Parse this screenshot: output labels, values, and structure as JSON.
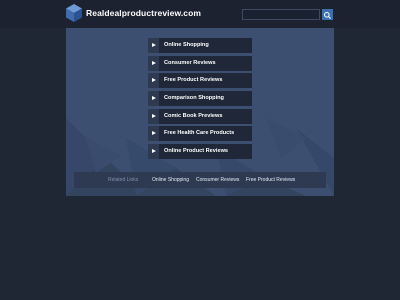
{
  "header": {
    "site_title": "Realdealproductreview.com",
    "search_value": ""
  },
  "links": [
    {
      "label": "Online Shopping"
    },
    {
      "label": "Consumer Reviews"
    },
    {
      "label": "Free Product Reviews"
    },
    {
      "label": "Comparison Shopping"
    },
    {
      "label": "Comic Book Previews"
    },
    {
      "label": "Free Health Care Products"
    },
    {
      "label": "Online Product Reviews"
    }
  ],
  "related": {
    "label": "Related Links",
    "links": [
      "Online Shopping",
      "Consumer Reviews",
      "Free Product Reviews"
    ]
  },
  "colors": {
    "background": "#202734",
    "panel": "#3c4f70",
    "link_bg": "#1f2738",
    "accent": "#3a6fb2"
  },
  "icons": [
    "cube-logo-icon",
    "search-icon",
    "arrow-right-icon"
  ]
}
